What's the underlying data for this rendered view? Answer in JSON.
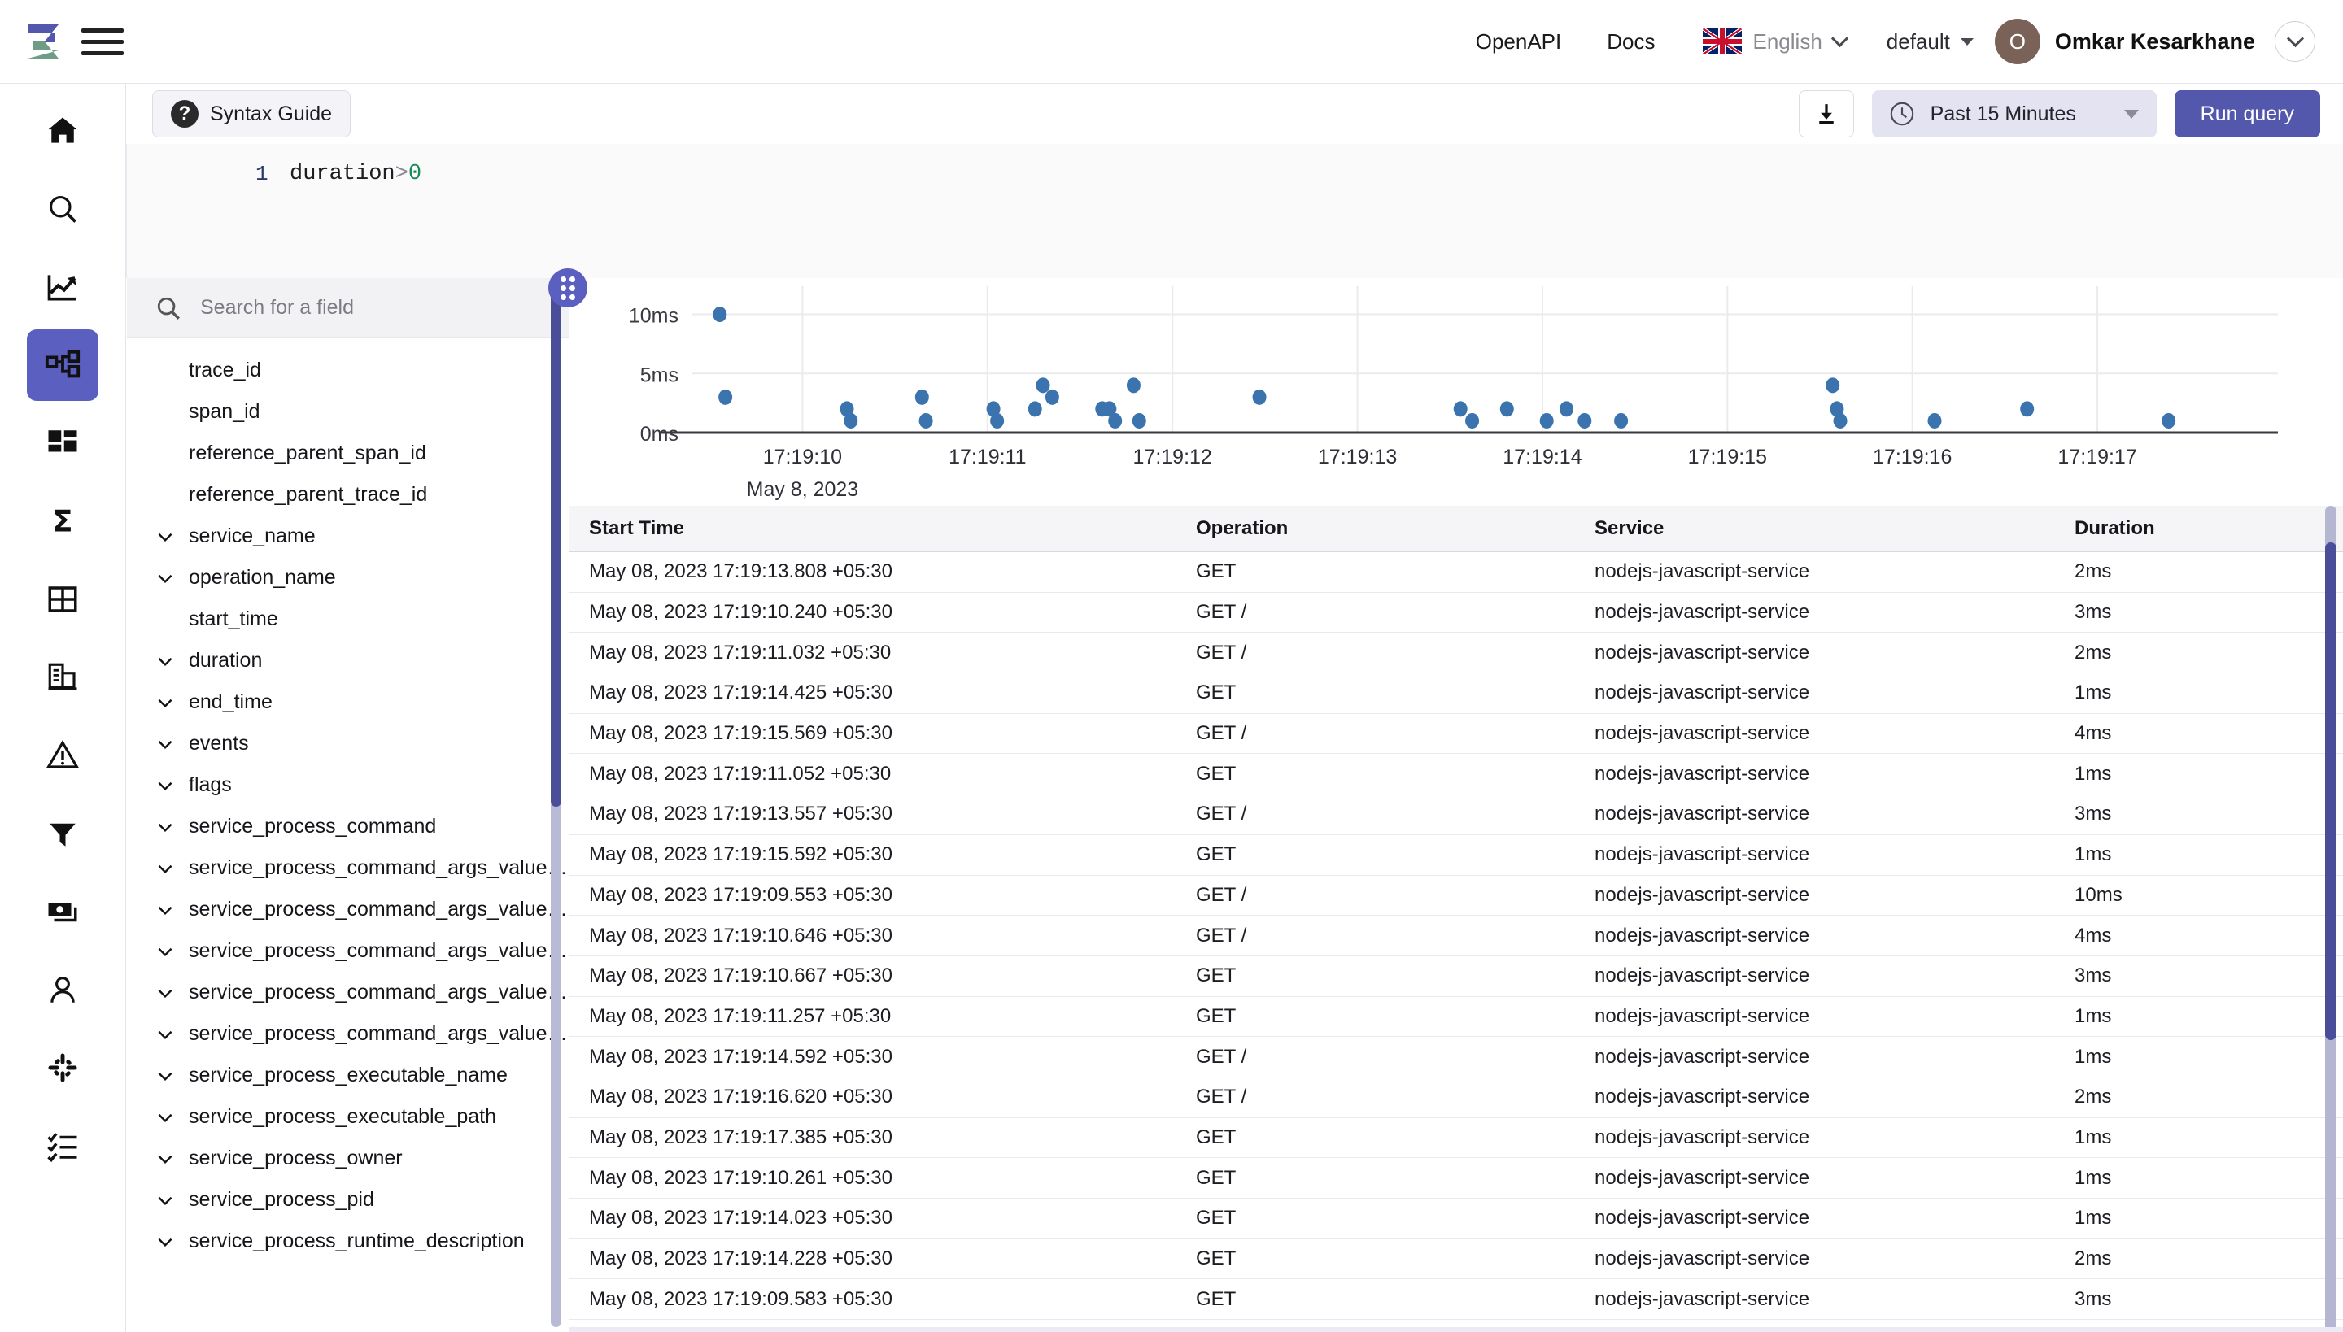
{
  "header": {
    "logo_name": "zinc-logo",
    "menu_icon": "hamburger-icon",
    "links": [
      {
        "label": "OpenAPI",
        "name": "openapi-link"
      },
      {
        "label": "Docs",
        "name": "docs-link"
      }
    ],
    "language": {
      "label": "English",
      "flag": "uk-flag-icon"
    },
    "org": {
      "label": "default"
    },
    "user": {
      "initial": "O",
      "name": "Omkar Kesarkhane"
    }
  },
  "rail": {
    "items": [
      {
        "name": "home-icon",
        "active": false
      },
      {
        "name": "search-icon",
        "active": false
      },
      {
        "name": "metrics-trend-icon",
        "active": false
      },
      {
        "name": "traces-icon",
        "active": true
      },
      {
        "name": "dashboards-icon",
        "active": false
      },
      {
        "name": "sum-sigma-icon",
        "active": false
      },
      {
        "name": "table-grid-icon",
        "active": false
      },
      {
        "name": "organization-icon",
        "active": false
      },
      {
        "name": "alerts-warning-icon",
        "active": false
      },
      {
        "name": "filter-funnel-icon",
        "active": false
      },
      {
        "name": "billing-icon",
        "active": false
      },
      {
        "name": "user-icon",
        "active": false
      },
      {
        "name": "slack-icon",
        "active": false
      },
      {
        "name": "checklist-icon",
        "active": false
      }
    ]
  },
  "toolbar": {
    "syntax_guide_label": "Syntax Guide",
    "download_icon": "download-icon",
    "time_range_label": "Past 15 Minutes",
    "clock_icon": "clock-icon",
    "run_query_label": "Run query",
    "accent_color": "#5358ad",
    "time_chip_bg": "#e3e3f1"
  },
  "editor": {
    "line_number": "1",
    "code_field": "duration",
    "code_operator": ">",
    "code_value": "0"
  },
  "fields": {
    "search_placeholder": "Search for a field",
    "search_icon": "search-icon",
    "items": [
      {
        "label": "trace_id",
        "expandable": false
      },
      {
        "label": "span_id",
        "expandable": false
      },
      {
        "label": "reference_parent_span_id",
        "expandable": false
      },
      {
        "label": "reference_parent_trace_id",
        "expandable": false
      },
      {
        "label": "service_name",
        "expandable": true
      },
      {
        "label": "operation_name",
        "expandable": true
      },
      {
        "label": "start_time",
        "expandable": false
      },
      {
        "label": "duration",
        "expandable": true
      },
      {
        "label": "end_time",
        "expandable": true
      },
      {
        "label": "events",
        "expandable": true
      },
      {
        "label": "flags",
        "expandable": true
      },
      {
        "label": "service_process_command",
        "expandable": true
      },
      {
        "label": "service_process_command_args_value…",
        "expandable": true
      },
      {
        "label": "service_process_command_args_value…",
        "expandable": true
      },
      {
        "label": "service_process_command_args_value…",
        "expandable": true
      },
      {
        "label": "service_process_command_args_value…",
        "expandable": true
      },
      {
        "label": "service_process_command_args_value…",
        "expandable": true
      },
      {
        "label": "service_process_executable_name",
        "expandable": true
      },
      {
        "label": "service_process_executable_path",
        "expandable": true
      },
      {
        "label": "service_process_owner",
        "expandable": true
      },
      {
        "label": "service_process_pid",
        "expandable": true
      },
      {
        "label": "service_process_runtime_description",
        "expandable": true
      }
    ]
  },
  "chart_data": {
    "type": "scatter",
    "title": "",
    "xlabel": "May 8, 2023",
    "ylabel": "",
    "ylim": [
      0,
      11
    ],
    "yticks": [
      "0ms",
      "5ms",
      "10ms"
    ],
    "ytick_values": [
      0,
      5,
      10
    ],
    "xticks": [
      "17:19:10",
      "17:19:11",
      "17:19:12",
      "17:19:13",
      "17:19:14",
      "17:19:15",
      "17:19:16",
      "17:19:17"
    ],
    "xlim": [
      "17:19:09.4",
      "17:19:17.8"
    ],
    "grid": true,
    "point_color": "#3a73ad",
    "points": [
      {
        "x": 9.553,
        "y": 10
      },
      {
        "x": 9.583,
        "y": 3
      },
      {
        "x": 10.24,
        "y": 2
      },
      {
        "x": 10.261,
        "y": 1
      },
      {
        "x": 10.646,
        "y": 3
      },
      {
        "x": 10.667,
        "y": 1
      },
      {
        "x": 11.032,
        "y": 2
      },
      {
        "x": 11.052,
        "y": 1
      },
      {
        "x": 11.257,
        "y": 2
      },
      {
        "x": 11.3,
        "y": 4
      },
      {
        "x": 11.35,
        "y": 3
      },
      {
        "x": 11.62,
        "y": 2
      },
      {
        "x": 11.66,
        "y": 2
      },
      {
        "x": 11.69,
        "y": 1
      },
      {
        "x": 11.79,
        "y": 4
      },
      {
        "x": 11.82,
        "y": 1
      },
      {
        "x": 12.47,
        "y": 3
      },
      {
        "x": 13.557,
        "y": 2
      },
      {
        "x": 13.62,
        "y": 1
      },
      {
        "x": 13.808,
        "y": 2
      },
      {
        "x": 14.023,
        "y": 1
      },
      {
        "x": 14.13,
        "y": 2
      },
      {
        "x": 14.228,
        "y": 1
      },
      {
        "x": 14.425,
        "y": 1
      },
      {
        "x": 15.569,
        "y": 4
      },
      {
        "x": 15.592,
        "y": 2
      },
      {
        "x": 15.61,
        "y": 1
      },
      {
        "x": 16.12,
        "y": 1
      },
      {
        "x": 16.62,
        "y": 2
      },
      {
        "x": 17.385,
        "y": 1
      }
    ]
  },
  "table": {
    "columns": [
      "Start Time",
      "Operation",
      "Service",
      "Duration"
    ],
    "rows": [
      [
        "May 08, 2023 17:19:13.808 +05:30",
        "GET",
        "nodejs-javascript-service",
        "2ms"
      ],
      [
        "May 08, 2023 17:19:10.240 +05:30",
        "GET /",
        "nodejs-javascript-service",
        "3ms"
      ],
      [
        "May 08, 2023 17:19:11.032 +05:30",
        "GET /",
        "nodejs-javascript-service",
        "2ms"
      ],
      [
        "May 08, 2023 17:19:14.425 +05:30",
        "GET",
        "nodejs-javascript-service",
        "1ms"
      ],
      [
        "May 08, 2023 17:19:15.569 +05:30",
        "GET /",
        "nodejs-javascript-service",
        "4ms"
      ],
      [
        "May 08, 2023 17:19:11.052 +05:30",
        "GET",
        "nodejs-javascript-service",
        "1ms"
      ],
      [
        "May 08, 2023 17:19:13.557 +05:30",
        "GET /",
        "nodejs-javascript-service",
        "3ms"
      ],
      [
        "May 08, 2023 17:19:15.592 +05:30",
        "GET",
        "nodejs-javascript-service",
        "1ms"
      ],
      [
        "May 08, 2023 17:19:09.553 +05:30",
        "GET /",
        "nodejs-javascript-service",
        "10ms"
      ],
      [
        "May 08, 2023 17:19:10.646 +05:30",
        "GET /",
        "nodejs-javascript-service",
        "4ms"
      ],
      [
        "May 08, 2023 17:19:10.667 +05:30",
        "GET",
        "nodejs-javascript-service",
        "3ms"
      ],
      [
        "May 08, 2023 17:19:11.257 +05:30",
        "GET",
        "nodejs-javascript-service",
        "1ms"
      ],
      [
        "May 08, 2023 17:19:14.592 +05:30",
        "GET /",
        "nodejs-javascript-service",
        "1ms"
      ],
      [
        "May 08, 2023 17:19:16.620 +05:30",
        "GET /",
        "nodejs-javascript-service",
        "2ms"
      ],
      [
        "May 08, 2023 17:19:17.385 +05:30",
        "GET",
        "nodejs-javascript-service",
        "1ms"
      ],
      [
        "May 08, 2023 17:19:10.261 +05:30",
        "GET",
        "nodejs-javascript-service",
        "1ms"
      ],
      [
        "May 08, 2023 17:19:14.023 +05:30",
        "GET",
        "nodejs-javascript-service",
        "1ms"
      ],
      [
        "May 08, 2023 17:19:14.228 +05:30",
        "GET",
        "nodejs-javascript-service",
        "2ms"
      ],
      [
        "May 08, 2023 17:19:09.583 +05:30",
        "GET",
        "nodejs-javascript-service",
        "3ms"
      ]
    ]
  }
}
